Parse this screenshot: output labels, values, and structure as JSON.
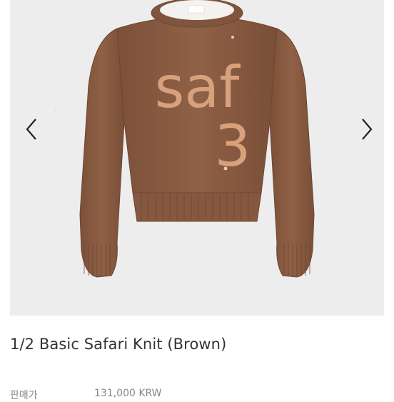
{
  "gallery": {
    "image_alt": "saf 3",
    "prev_icon": "chevron-left-icon",
    "next_icon": "chevron-right-icon",
    "knit_letters": "saf",
    "knit_number": "3"
  },
  "product": {
    "title": "1/2 Basic Safari Knit (Brown)",
    "price_label": "판매가",
    "price_value": "131,000 KRW"
  },
  "colors": {
    "background": "#ffffff",
    "gallery_bg": "#ededed",
    "sweater_brown": "#8b5e44",
    "letter_tan": "#d9a07c",
    "title_text": "#333333"
  }
}
